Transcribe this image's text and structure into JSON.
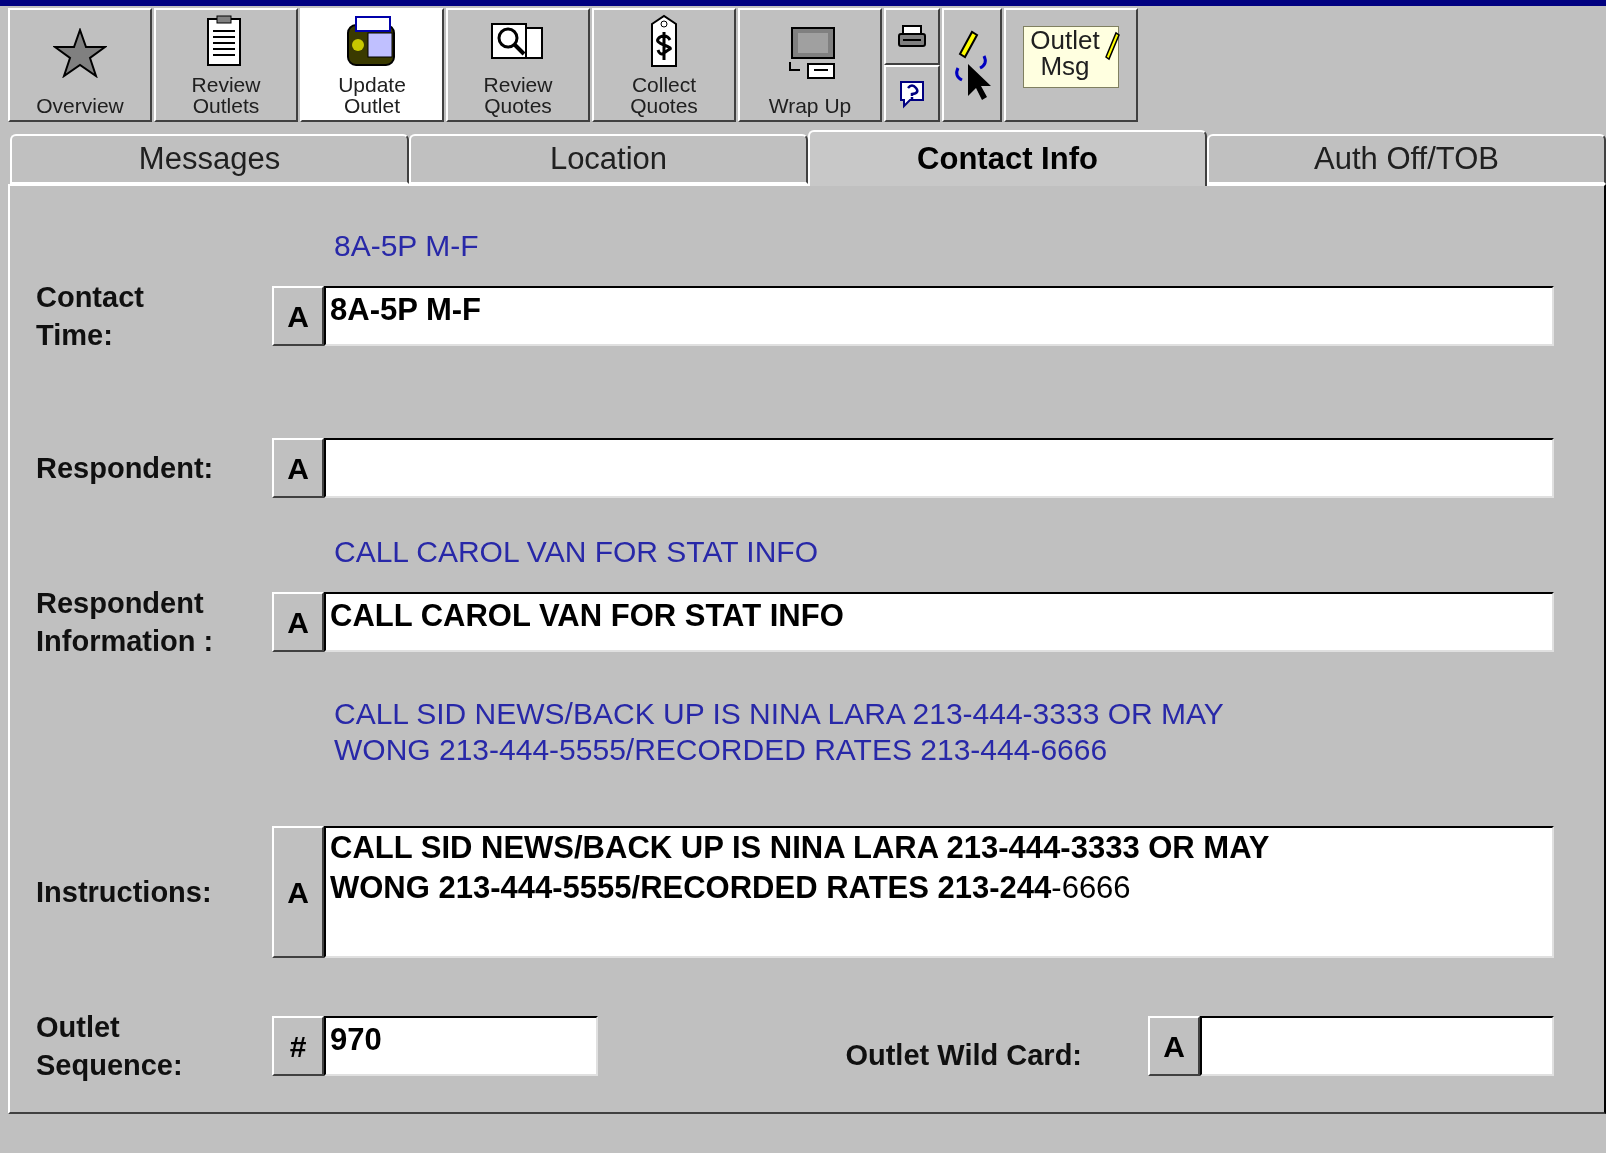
{
  "toolbar": {
    "buttons": [
      {
        "kind": "star",
        "lines": [
          "Overview"
        ],
        "selected": false
      },
      {
        "kind": "clipboard",
        "lines": [
          "Review",
          "Outlets"
        ],
        "selected": false
      },
      {
        "kind": "machine",
        "lines": [
          "Update",
          "Outlet"
        ],
        "selected": true
      },
      {
        "kind": "magnifier",
        "lines": [
          "Review",
          "Quotes"
        ],
        "selected": false
      },
      {
        "kind": "tag",
        "lines": [
          "Collect",
          "Quotes"
        ],
        "selected": false
      },
      {
        "kind": "computer",
        "lines": [
          "Wrap Up"
        ],
        "selected": false
      },
      {
        "kind": "stack",
        "selected": false
      },
      {
        "kind": "pointer",
        "selected": false
      },
      {
        "kind": "note",
        "lines": [
          "Outlet",
          "Msg"
        ],
        "selected": false
      }
    ]
  },
  "tabs": [
    {
      "label": "Messages",
      "selected": false
    },
    {
      "label": "Location",
      "selected": false
    },
    {
      "label": "Contact Info",
      "selected": true
    },
    {
      "label": "Auth Off/TOB",
      "selected": false
    }
  ],
  "fields": [
    {
      "hint": [
        "8A-5P M-F"
      ],
      "label": [
        "Contact",
        "Time:"
      ],
      "key": "A",
      "value": "8A-5P M-F",
      "kind": "line"
    },
    {
      "label": [
        "Respondent:"
      ],
      "key": "A",
      "kind": "line"
    },
    {
      "hint": [
        "CALL CAROL VAN FOR STAT INFO"
      ],
      "label": [
        "Respondent",
        "Information :"
      ],
      "key": "A",
      "value": "CALL CAROL VAN FOR STAT INFO",
      "kind": "line"
    },
    {
      "hint": [
        "CALL SID NEWS/BACK UP IS NINA LARA 213-444-3333 OR MAY",
        "WONG 213-444-5555/RECORDED RATES 213-444-6666"
      ],
      "label": [
        "Instructions:"
      ],
      "key": "A",
      "value_lines": [
        "CALL SID NEWS/BACK UP IS NINA LARA 213-444-3333 OR MAY",
        "**WONG 213-444-5555/RECORDED RATES 213-244**-6666"
      ],
      "kind": "area"
    }
  ],
  "sequence": {
    "label": [
      "Outlet",
      "Sequence:"
    ],
    "key": "#",
    "value": "970"
  },
  "wild_card": {
    "label": "Outlet Wild Card:",
    "key": "A"
  }
}
